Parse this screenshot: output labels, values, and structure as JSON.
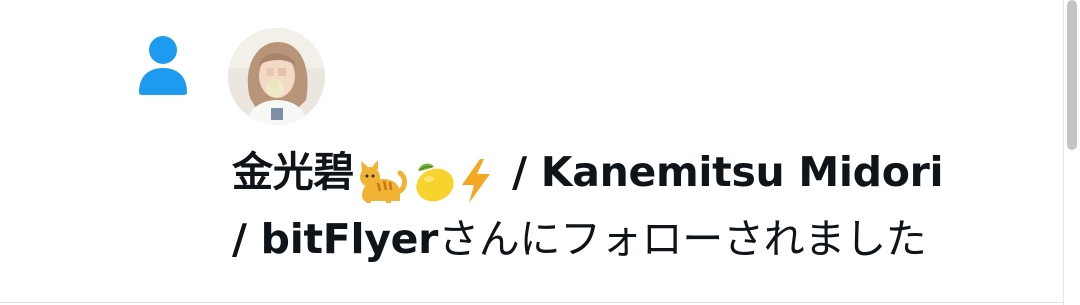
{
  "notification": {
    "type_icon": "person-icon",
    "accent_color": "#1d9bf0",
    "user": {
      "display_name_part1": "金光碧",
      "emojis": [
        "cat-emoji",
        "lemon-emoji",
        "lightning-emoji"
      ],
      "display_name_part2": " / Kanemitsu Midori",
      "display_name_part3": "/ bitFlyer",
      "avatar": "user-avatar"
    },
    "action_text": "さんにフォローされました"
  }
}
